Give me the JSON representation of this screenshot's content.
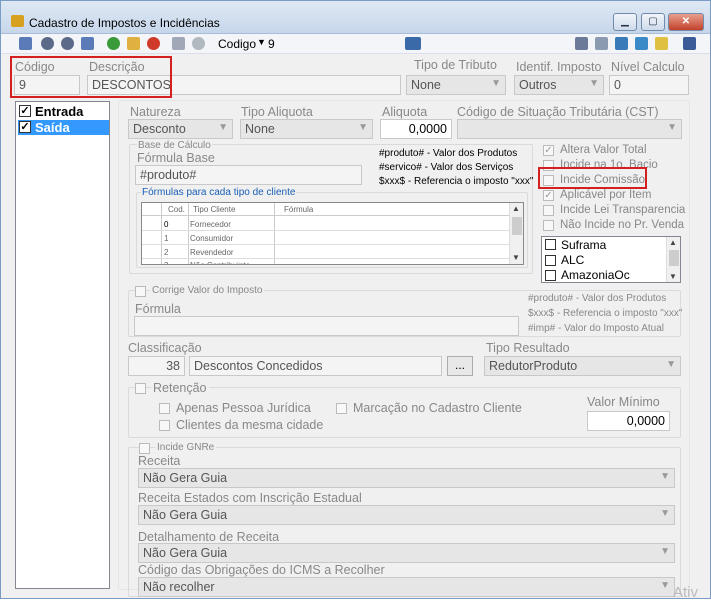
{
  "window": {
    "title": "Cadastro de Impostos e Incidências",
    "minimize": "▁",
    "maximize": "▢",
    "close": "✕"
  },
  "toolbar": {
    "search_label": "Codigo",
    "search_value": "9"
  },
  "header": {
    "codigo_label": "Código",
    "codigo_value": "9",
    "descricao_label": "Descrição",
    "descricao_value": "DESCONTOS",
    "tipo_tributo_label": "Tipo de Tributo",
    "tipo_tributo_value": "None",
    "ident_imposto_label": "Identif. Imposto",
    "ident_imposto_value": "Outros",
    "nivel_calculo_label": "Nível Calculo",
    "nivel_calculo_value": "0"
  },
  "side_list": [
    {
      "label": "Entrada",
      "checked": true
    },
    {
      "label": "Saída",
      "checked": true
    }
  ],
  "row1": {
    "natureza_label": "Natureza",
    "natureza_value": "Desconto",
    "tipo_aliquota_label": "Tipo Aliquota",
    "tipo_aliquota_value": "None",
    "aliquota_label": "Aliquota",
    "aliquota_value": "0,0000",
    "cst_label": "Código de Situação Tributária (CST)",
    "cst_value": ""
  },
  "base_calculo": {
    "group_label": "Base de Cálculo",
    "formula_label": "Fórmula Base",
    "formula_value": "#produto#",
    "hints": [
      "#produto# - Valor dos Produtos",
      "#servico# - Valor dos Serviços",
      "$xxx$ - Referencia o imposto \"xxx\""
    ],
    "formulas_group_label": "Fórmulas para cada tipo de cliente",
    "columns": [
      "Cod.",
      "Tipo Cliente",
      "Fórmula"
    ],
    "rows": [
      {
        "cod": "0",
        "tipo": "Fornecedor",
        "formula": ""
      },
      {
        "cod": "1",
        "tipo": "Consumidor",
        "formula": ""
      },
      {
        "cod": "2",
        "tipo": "Revendedor",
        "formula": ""
      },
      {
        "cod": "3",
        "tipo": "Não Contribuinte",
        "formula": ""
      }
    ]
  },
  "right_checks": [
    {
      "label": "Altera Valor Total",
      "checked": true
    },
    {
      "label": "Incide na 1o. Bacio",
      "checked": false
    },
    {
      "label": "Incide Comissão",
      "checked": false
    },
    {
      "label": "Aplicável por Item",
      "checked": true
    },
    {
      "label": "Incide Lei Transparencia",
      "checked": false
    },
    {
      "label": "Não Incide no Pr. Venda",
      "checked": false
    }
  ],
  "regions": [
    "Suframa",
    "ALC",
    "AmazoniaOc"
  ],
  "corrige": {
    "label": "Corrige Valor do Imposto",
    "formula_label": "Fórmula",
    "formula_value": "",
    "hints": [
      "#produto# - Valor dos Produtos",
      "$xxx$ - Referencia o imposto \"xxx\"",
      "#imp# - Valor do Imposto Atual"
    ]
  },
  "classificacao": {
    "label": "Classificação",
    "code": "38",
    "description": "Descontos Concedidos",
    "button": "...",
    "tipo_resultado_label": "Tipo Resultado",
    "tipo_resultado_value": "RedutorProduto"
  },
  "retencao": {
    "label": "Retenção",
    "pj": "Apenas Pessoa Jurídica",
    "cidade": "Clientes da mesma cidade",
    "marcacao": "Marcação no Cadastro Cliente",
    "valor_minimo_label": "Valor Mínimo",
    "valor_minimo_value": "0,0000"
  },
  "gnre": {
    "label": "Incide GNRe",
    "receita_label": "Receita",
    "receita_value": "Não Gera Guia",
    "receita_ie_label": "Receita Estados com Inscrição Estadual",
    "receita_ie_value": "Não Gera Guia",
    "detalhamento_label": "Detalhamento de Receita",
    "detalhamento_value": "Não Gera Guia",
    "obrigacoes_label": "Código das Obrigações do ICMS a Recolher",
    "obrigacoes_value": "Não recolher"
  },
  "watermark": "Ativ"
}
